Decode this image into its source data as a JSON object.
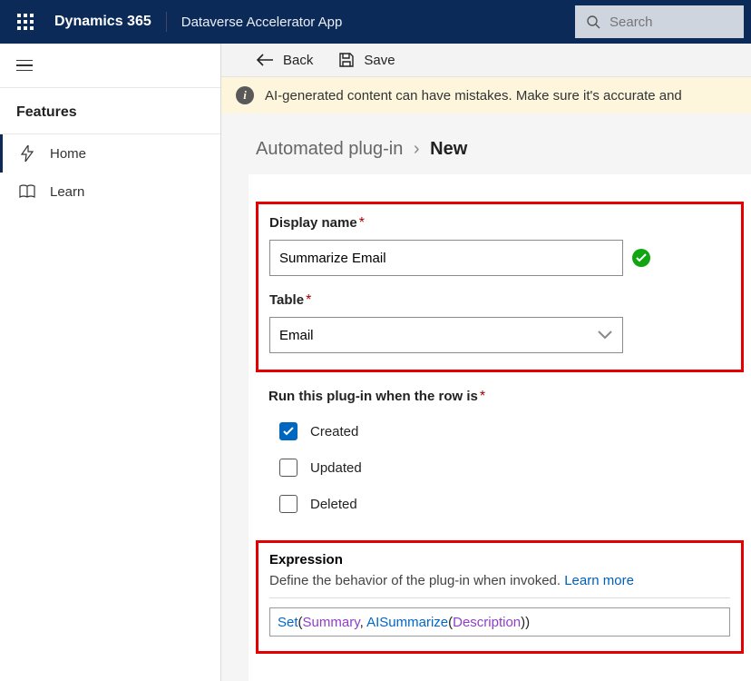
{
  "topbar": {
    "brand": "Dynamics 365",
    "app_name": "Dataverse Accelerator App",
    "search_placeholder": "Search"
  },
  "sidebar": {
    "section_title": "Features",
    "items": [
      {
        "label": "Home",
        "icon": "lightning"
      },
      {
        "label": "Learn",
        "icon": "book"
      }
    ]
  },
  "toolbar": {
    "back_label": "Back",
    "save_label": "Save"
  },
  "banner": {
    "text": "AI-generated content can have mistakes. Make sure it's accurate and"
  },
  "breadcrumb": {
    "parent": "Automated plug-in",
    "current": "New"
  },
  "form": {
    "display_name_label": "Display name",
    "display_name_value": "Summarize Email",
    "table_label": "Table",
    "table_value": "Email",
    "run_label": "Run this plug-in when the row is",
    "options": [
      {
        "label": "Created",
        "checked": true
      },
      {
        "label": "Updated",
        "checked": false
      },
      {
        "label": "Deleted",
        "checked": false
      }
    ],
    "expression_title": "Expression",
    "expression_desc": "Define the behavior of the plug-in when invoked. ",
    "learn_more": "Learn more",
    "expression_tokens": {
      "fn1": "Set",
      "p1": "(",
      "ref1": "Summary",
      "comma": ", ",
      "fn2": "AISummarize",
      "p2": "(",
      "ref2": "Description",
      "p3": ")",
      "p4": ")"
    }
  }
}
